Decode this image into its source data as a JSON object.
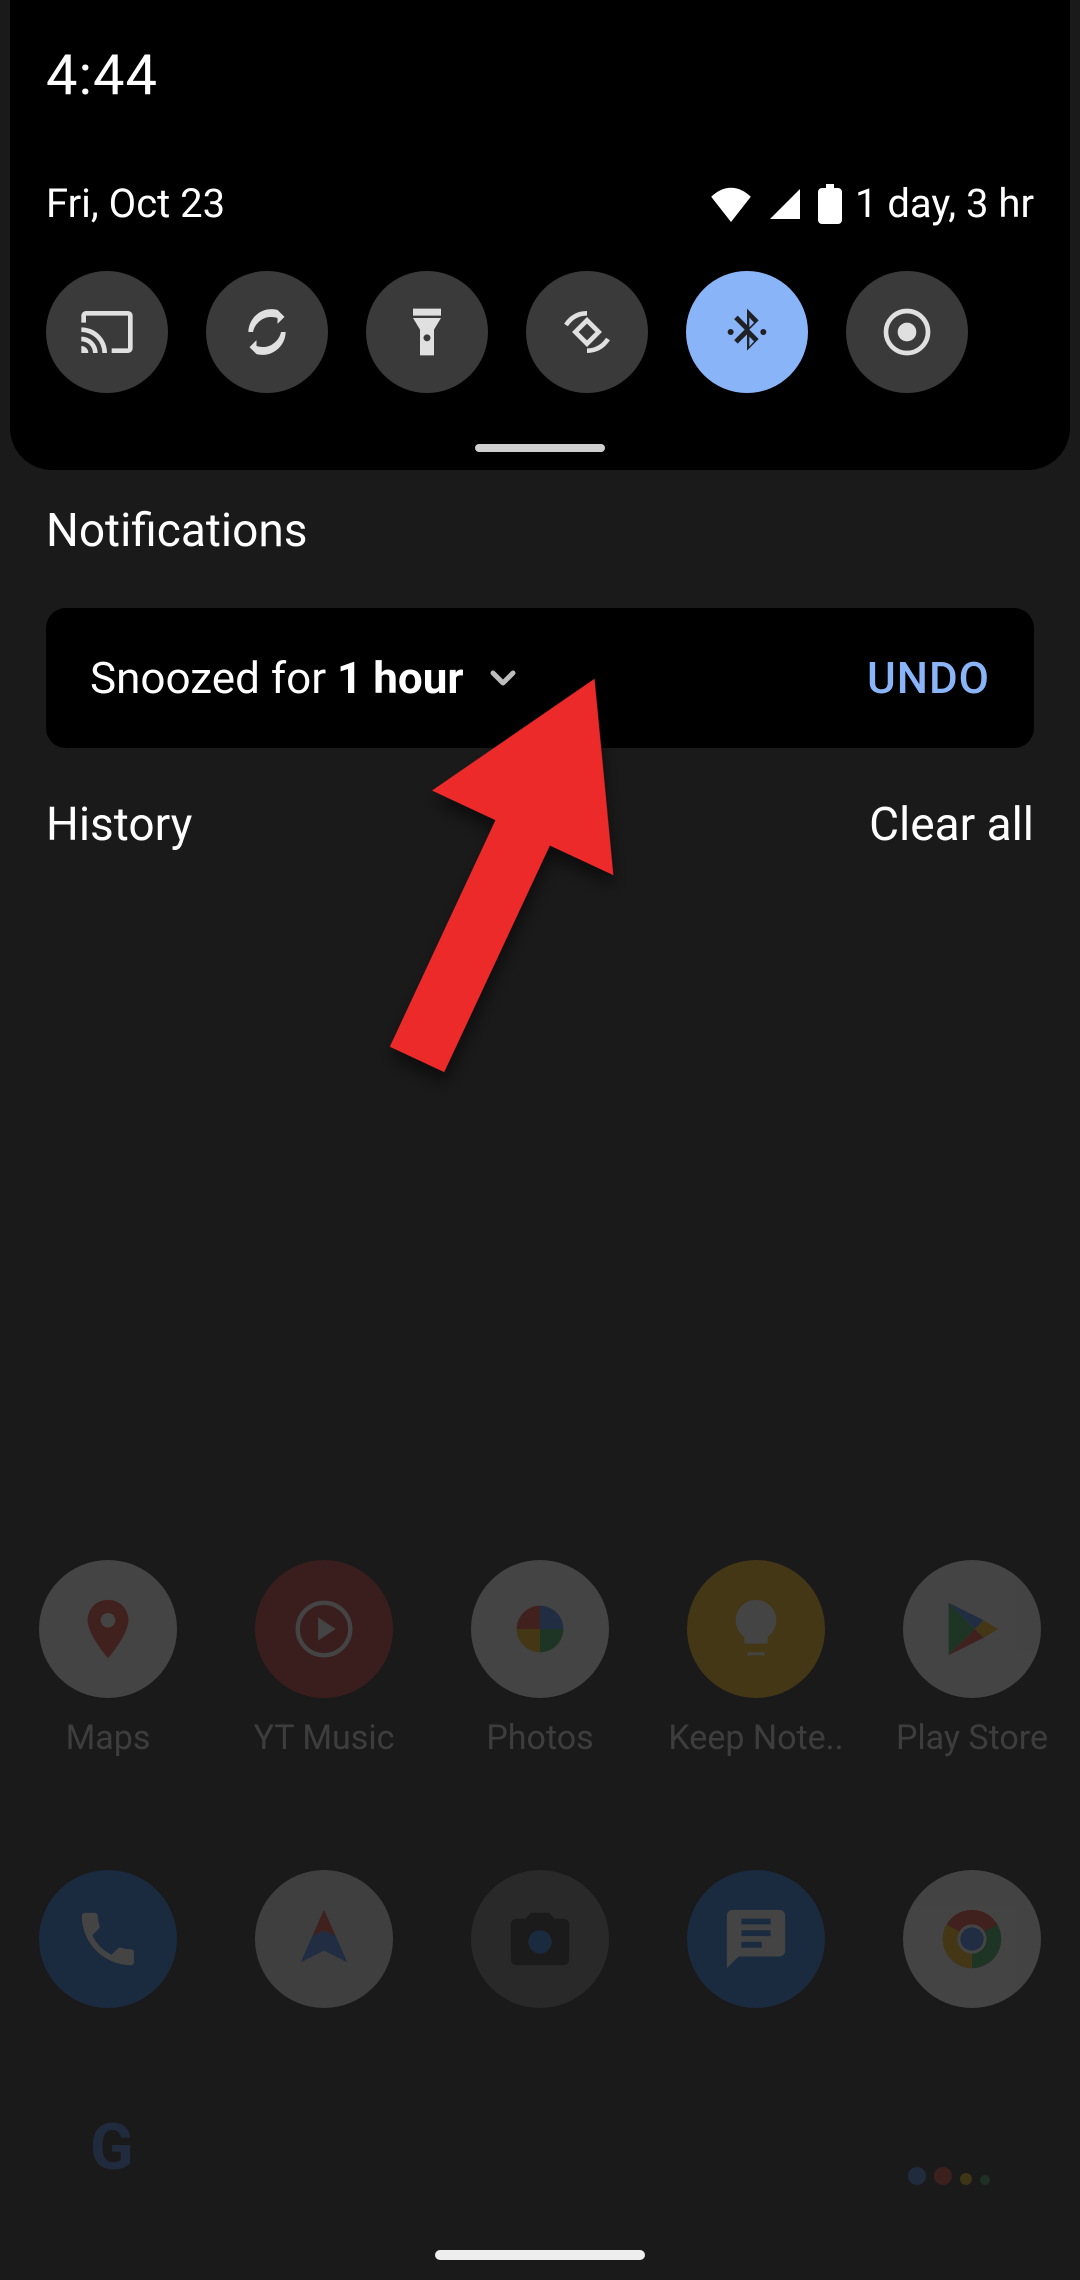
{
  "statusbar": {
    "time": "4:44"
  },
  "shade": {
    "date": "Fri, Oct 23",
    "battery_text": "1 day, 3 hr",
    "tiles": [
      {
        "name": "cast",
        "active": false
      },
      {
        "name": "autorotate",
        "active": false
      },
      {
        "name": "flashlight",
        "active": false
      },
      {
        "name": "shuffle",
        "active": false
      },
      {
        "name": "bluetooth",
        "active": true
      },
      {
        "name": "live-caption",
        "active": false
      }
    ]
  },
  "notifications": {
    "heading": "Notifications",
    "snooze": {
      "prefix": "Snoozed for ",
      "duration": "1 hour",
      "undo": "UNDO"
    },
    "history": "History",
    "clear_all": "Clear all"
  },
  "home": {
    "row1": [
      "Maps",
      "YT Music",
      "Photos",
      "Keep Note..",
      "Play Store"
    ],
    "row2_names": [
      "phone",
      "navigation",
      "camera",
      "messages",
      "chrome"
    ]
  },
  "accent": "#8ab4f8",
  "annotation": {
    "arrow_color": "#ed2b2b"
  }
}
